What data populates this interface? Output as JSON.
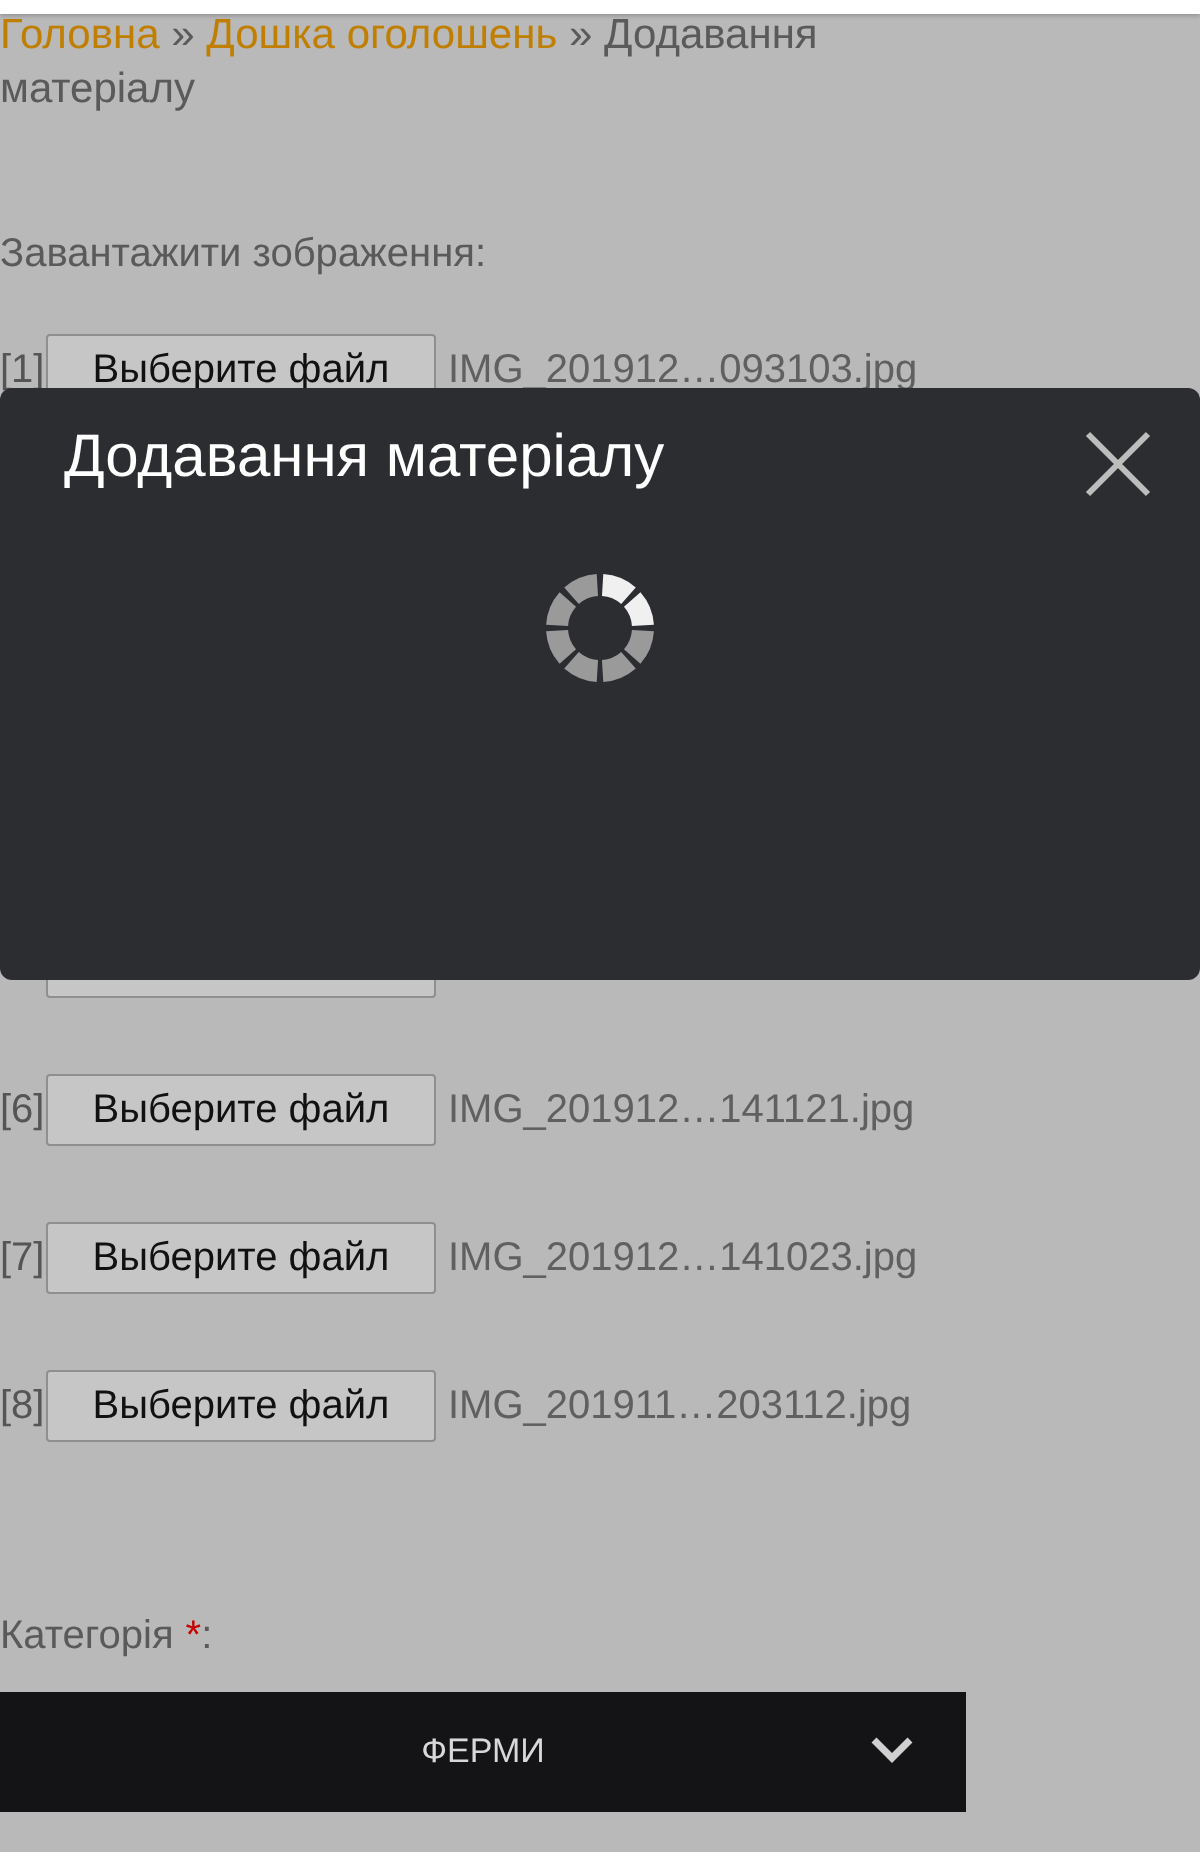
{
  "breadcrumb": {
    "links": [
      "Головна",
      "Дошка оголошень"
    ],
    "separator": "»",
    "current_lines": [
      "Додавання",
      "матеріалу"
    ]
  },
  "upload": {
    "label": "Завантажити зображення:",
    "rows": [
      {
        "kind": "file",
        "index": "[1]",
        "button": "Выберите файл",
        "filename": "IMG_201912…093103.jpg"
      },
      {
        "kind": "edge"
      },
      {
        "kind": "file",
        "index": "[6]",
        "button": "Выберите файл",
        "filename": "IMG_201912…141121.jpg"
      },
      {
        "kind": "file",
        "index": "[7]",
        "button": "Выберите файл",
        "filename": "IMG_201912…141023.jpg"
      },
      {
        "kind": "file",
        "index": "[8]",
        "button": "Выберите файл",
        "filename": "IMG_201911…203112.jpg"
      }
    ]
  },
  "category": {
    "label": "Категорія",
    "required_mark": "*",
    "colon": ":",
    "value": "ФЕРМИ"
  },
  "modal": {
    "title": "Додавання матеріалу",
    "loading": true
  }
}
